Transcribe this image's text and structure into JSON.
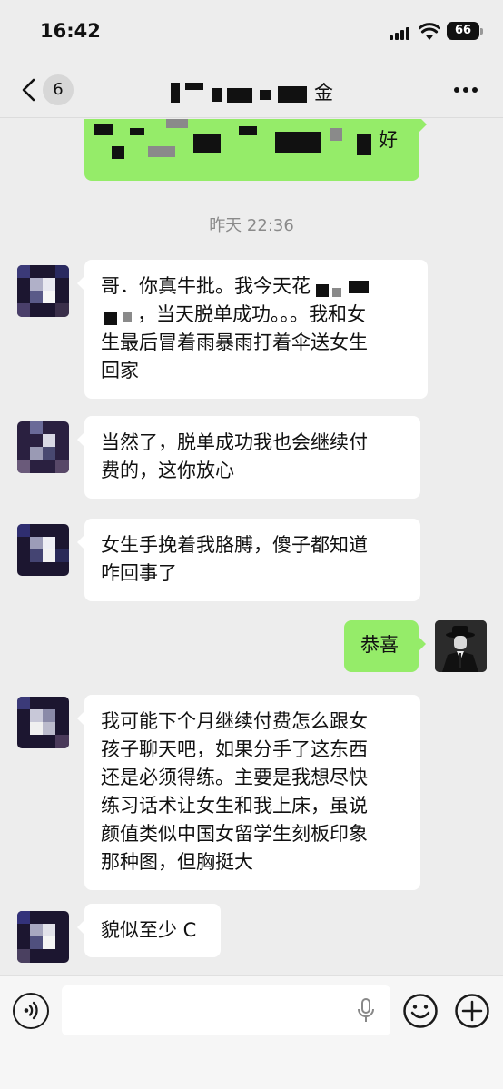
{
  "status_bar": {
    "time": "16:42",
    "battery": "66"
  },
  "nav": {
    "unread_count": "6",
    "title_visible_char": "金"
  },
  "chat": {
    "timestamp": "昨天 22:36",
    "top_bubble_visible_text": "好",
    "messages": [
      {
        "side": "in",
        "lines": [
          "哥．你真牛批。我今天花",
          "，当天脱单成功。。。我和女",
          "生最后冒着雨暴雨打着伞送女生",
          "回家"
        ]
      },
      {
        "side": "in",
        "lines": [
          "当然了，脱单成功我也会继续付",
          "费的，这你放心"
        ]
      },
      {
        "side": "in",
        "lines": [
          "女生手挽着我胳膊，傻子都知道",
          "咋回事了"
        ]
      },
      {
        "side": "out",
        "lines": [
          "恭喜"
        ]
      },
      {
        "side": "in",
        "lines": [
          "我可能下个月继续付费怎么跟女",
          "孩子聊天吧，如果分手了这东西",
          "还是必须得练。主要是我想尽快",
          "练习话术让女生和我上床，虽说",
          "颜值类似中国女留学生刻板印象",
          "那种图，但胸挺大"
        ]
      },
      {
        "side": "in",
        "lines": [
          "貌似至少 C"
        ]
      }
    ]
  },
  "input": {
    "value": "",
    "placeholder": ""
  },
  "icons": {
    "back": "chevron-left-icon",
    "more": "ellipsis-icon",
    "voice": "voice-icon",
    "mic": "microphone-icon",
    "emoji": "emoji-icon",
    "add": "plus-icon"
  },
  "colors": {
    "background": "#ededed",
    "outgoing_bubble": "#95ec69",
    "incoming_bubble": "#ffffff",
    "timestamp_text": "#8a8a8a"
  }
}
